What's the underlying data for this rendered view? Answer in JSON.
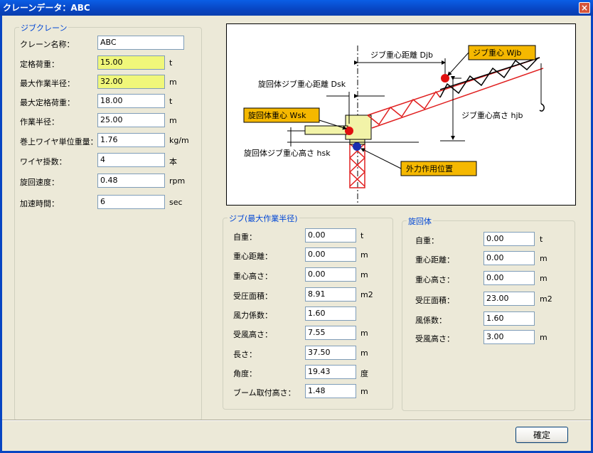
{
  "window": {
    "title": "クレーンデータ：ABC",
    "close_glyph": "×"
  },
  "jib_crane": {
    "title": "ジブクレーン",
    "fields": [
      {
        "label": "クレーン名称：",
        "value": "ABC",
        "unit": ""
      },
      {
        "label": "定格荷重：",
        "value": "15.00",
        "unit": "t"
      },
      {
        "label": "最大作業半径：",
        "value": "32.00",
        "unit": "m"
      },
      {
        "label": "最大定格荷重：",
        "value": "18.00",
        "unit": "t"
      },
      {
        "label": "作業半径：",
        "value": "25.00",
        "unit": "m"
      },
      {
        "label": "巻上ワイヤ単位重量：",
        "value": "1.76",
        "unit": "kg/m"
      },
      {
        "label": "ワイヤ掛数：",
        "value": "4",
        "unit": "本"
      },
      {
        "label": "旋回速度：",
        "value": "0.48",
        "unit": "rpm"
      },
      {
        "label": "加速時間：",
        "value": "6",
        "unit": "sec"
      }
    ]
  },
  "diagram": {
    "jib_cg_distance": "ジブ重心距離 Djb",
    "jib_cg": "ジブ重心 Wjb",
    "slew_jib_cg_distance": "旋回体ジブ重心距離 Dsk",
    "slew_cg": "旋回体重心 Wsk",
    "jib_cg_height": "ジブ重心高さ hjb",
    "slew_jib_cg_height": "旋回体ジブ重心高さ hsk",
    "external_force_pos": "外力作用位置"
  },
  "jib_max": {
    "title": "ジブ(最大作業半径)",
    "fields": [
      {
        "label": "自重：",
        "value": "0.00",
        "unit": "t"
      },
      {
        "label": "重心距離：",
        "value": "0.00",
        "unit": "m"
      },
      {
        "label": "重心高さ：",
        "value": "0.00",
        "unit": "m"
      },
      {
        "label": "受圧面積：",
        "value": "8.91",
        "unit": "m2"
      },
      {
        "label": "風力係数：",
        "value": "1.60",
        "unit": ""
      },
      {
        "label": "受風高さ：",
        "value": "7.55",
        "unit": "m"
      },
      {
        "label": "長さ：",
        "value": "37.50",
        "unit": "m"
      },
      {
        "label": "角度：",
        "value": "19.43",
        "unit": "度"
      },
      {
        "label": "ブーム取付高さ：",
        "value": "1.48",
        "unit": "m"
      }
    ]
  },
  "slewing": {
    "title": "旋回体",
    "fields": [
      {
        "label": "自重：",
        "value": "0.00",
        "unit": "t"
      },
      {
        "label": "重心距離：",
        "value": "0.00",
        "unit": "m"
      },
      {
        "label": "重心高さ：",
        "value": "0.00",
        "unit": "m"
      },
      {
        "label": "受圧面積：",
        "value": "23.00",
        "unit": "m2"
      },
      {
        "label": "風係数：",
        "value": "1.60",
        "unit": ""
      },
      {
        "label": "受風高さ：",
        "value": "3.00",
        "unit": "m"
      }
    ]
  },
  "ok_label": "確定"
}
